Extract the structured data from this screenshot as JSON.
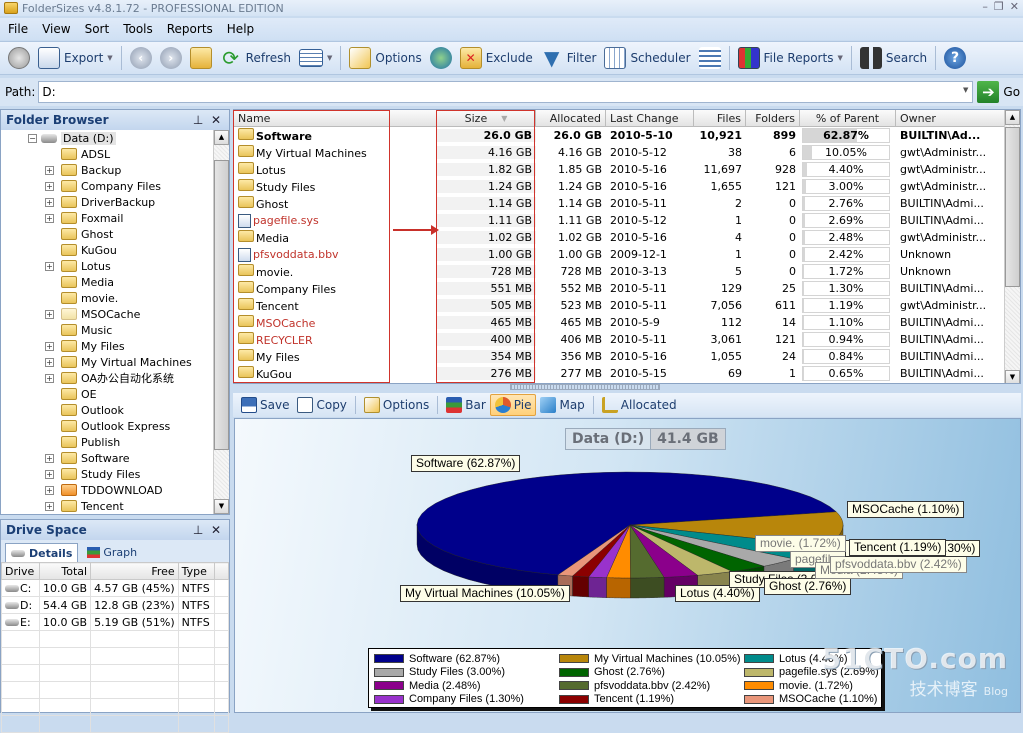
{
  "window": {
    "title": "FolderSizes v4.8.1.72 - PROFESSIONAL EDITION",
    "controls": [
      "minimize",
      "restore",
      "close"
    ]
  },
  "menu": [
    "File",
    "View",
    "Sort",
    "Tools",
    "Reports",
    "Help"
  ],
  "toolbar": {
    "stop": "stop-icon",
    "export": "Export",
    "back": "back-icon",
    "forward": "forward-icon",
    "up": "folder-up-icon",
    "refresh": "Refresh",
    "view_menu": "view-list-icon",
    "options": "Options",
    "network": "network-icon",
    "exclude": "Exclude",
    "filter": "Filter",
    "scheduler": "Scheduler",
    "import": "import-icon",
    "file_reports": "File Reports",
    "search": "Search",
    "help": "help-icon"
  },
  "path": {
    "label": "Path:",
    "value": "D:",
    "go": "Go"
  },
  "folder_browser": {
    "title": "Folder Browser",
    "root": "Data (D:)",
    "items": [
      {
        "name": "ADSL",
        "expandable": false
      },
      {
        "name": "Backup",
        "expandable": true
      },
      {
        "name": "Company Files",
        "expandable": true
      },
      {
        "name": "DriverBackup",
        "expandable": true
      },
      {
        "name": "Foxmail",
        "expandable": true
      },
      {
        "name": "Ghost",
        "expandable": false
      },
      {
        "name": "KuGou",
        "expandable": false
      },
      {
        "name": "Lotus",
        "expandable": true
      },
      {
        "name": "Media",
        "expandable": false
      },
      {
        "name": "movie.",
        "expandable": false
      },
      {
        "name": "MSOCache",
        "expandable": true
      },
      {
        "name": "Music",
        "expandable": false
      },
      {
        "name": "My Files",
        "expandable": true
      },
      {
        "name": "My Virtual Machines",
        "expandable": true
      },
      {
        "name": "OA办公自动化系统",
        "expandable": true
      },
      {
        "name": "OE",
        "expandable": false
      },
      {
        "name": "Outlook",
        "expandable": false
      },
      {
        "name": "Outlook Express",
        "expandable": false
      },
      {
        "name": "Publish",
        "expandable": false
      },
      {
        "name": "Software",
        "expandable": true
      },
      {
        "name": "Study Files",
        "expandable": true
      },
      {
        "name": "TDDOWNLOAD",
        "expandable": true
      },
      {
        "name": "Tencent",
        "expandable": true
      }
    ]
  },
  "drive_space": {
    "title": "Drive Space",
    "tabs": [
      "Details",
      "Graph"
    ],
    "columns": [
      "Drive",
      "Total",
      "Free",
      "Type"
    ],
    "rows": [
      {
        "drive": "C:",
        "total": "10.0 GB",
        "free": "4.57 GB (45%)",
        "type": "NTFS"
      },
      {
        "drive": "D:",
        "total": "54.4 GB",
        "free": "12.8 GB (23%)",
        "type": "NTFS"
      },
      {
        "drive": "E:",
        "total": "10.0 GB",
        "free": "5.19 GB (51%)",
        "type": "NTFS"
      }
    ]
  },
  "grid": {
    "columns": [
      "Name",
      "Size",
      "Allocated",
      "Last Change",
      "Files",
      "Folders",
      "% of Parent",
      "Owner"
    ],
    "sort_column": "Size",
    "rows": [
      {
        "name": "Software",
        "kind": "folder",
        "size": "26.0 GB",
        "allocated": "26.0 GB",
        "last_change": "2010-5-10",
        "files": "10,921",
        "folders": "899",
        "pct": "62.87%",
        "pct_value": 62.87,
        "owner": "BUILTIN\\Ad...",
        "bold": true,
        "red": false
      },
      {
        "name": "My Virtual Machines",
        "kind": "folder",
        "size": "4.16 GB",
        "allocated": "4.16 GB",
        "last_change": "2010-5-12",
        "files": "38",
        "folders": "6",
        "pct": "10.05%",
        "pct_value": 10.05,
        "owner": "gwt\\Administr...",
        "bold": false,
        "red": false
      },
      {
        "name": "Lotus",
        "kind": "folder",
        "size": "1.82 GB",
        "allocated": "1.85 GB",
        "last_change": "2010-5-16",
        "files": "11,697",
        "folders": "928",
        "pct": "4.40%",
        "pct_value": 4.4,
        "owner": "gwt\\Administr...",
        "bold": false,
        "red": false
      },
      {
        "name": "Study Files",
        "kind": "folder",
        "size": "1.24 GB",
        "allocated": "1.24 GB",
        "last_change": "2010-5-16",
        "files": "1,655",
        "folders": "121",
        "pct": "3.00%",
        "pct_value": 3.0,
        "owner": "gwt\\Administr...",
        "bold": false,
        "red": false
      },
      {
        "name": "Ghost",
        "kind": "folder",
        "size": "1.14 GB",
        "allocated": "1.14 GB",
        "last_change": "2010-5-11",
        "files": "2",
        "folders": "0",
        "pct": "2.76%",
        "pct_value": 2.76,
        "owner": "BUILTIN\\Admi...",
        "bold": false,
        "red": false
      },
      {
        "name": "pagefile.sys",
        "kind": "file",
        "size": "1.11 GB",
        "allocated": "1.11 GB",
        "last_change": "2010-5-12",
        "files": "1",
        "folders": "0",
        "pct": "2.69%",
        "pct_value": 2.69,
        "owner": "BUILTIN\\Admi...",
        "bold": false,
        "red": true
      },
      {
        "name": "Media",
        "kind": "folder",
        "size": "1.02 GB",
        "allocated": "1.02 GB",
        "last_change": "2010-5-16",
        "files": "4",
        "folders": "0",
        "pct": "2.48%",
        "pct_value": 2.48,
        "owner": "gwt\\Administr...",
        "bold": false,
        "red": false
      },
      {
        "name": "pfsvoddata.bbv",
        "kind": "file",
        "size": "1.00 GB",
        "allocated": "1.00 GB",
        "last_change": "2009-12-1",
        "files": "1",
        "folders": "0",
        "pct": "2.42%",
        "pct_value": 2.42,
        "owner": "Unknown",
        "bold": false,
        "red": true
      },
      {
        "name": "movie.",
        "kind": "folder",
        "size": "728 MB",
        "allocated": "728 MB",
        "last_change": "2010-3-13",
        "files": "5",
        "folders": "0",
        "pct": "1.72%",
        "pct_value": 1.72,
        "owner": "Unknown",
        "bold": false,
        "red": false
      },
      {
        "name": "Company Files",
        "kind": "folder",
        "size": "551 MB",
        "allocated": "552 MB",
        "last_change": "2010-5-11",
        "files": "129",
        "folders": "25",
        "pct": "1.30%",
        "pct_value": 1.3,
        "owner": "BUILTIN\\Admi...",
        "bold": false,
        "red": false
      },
      {
        "name": "Tencent",
        "kind": "folder",
        "size": "505 MB",
        "allocated": "523 MB",
        "last_change": "2010-5-11",
        "files": "7,056",
        "folders": "611",
        "pct": "1.19%",
        "pct_value": 1.19,
        "owner": "gwt\\Administr...",
        "bold": false,
        "red": false
      },
      {
        "name": "MSOCache",
        "kind": "folder",
        "size": "465 MB",
        "allocated": "465 MB",
        "last_change": "2010-5-9",
        "files": "112",
        "folders": "14",
        "pct": "1.10%",
        "pct_value": 1.1,
        "owner": "BUILTIN\\Admi...",
        "bold": false,
        "red": true
      },
      {
        "name": "RECYCLER",
        "kind": "folder",
        "size": "400 MB",
        "allocated": "406 MB",
        "last_change": "2010-5-11",
        "files": "3,061",
        "folders": "121",
        "pct": "0.94%",
        "pct_value": 0.94,
        "owner": "BUILTIN\\Admi...",
        "bold": false,
        "red": true
      },
      {
        "name": "My Files",
        "kind": "folder",
        "size": "354 MB",
        "allocated": "356 MB",
        "last_change": "2010-5-16",
        "files": "1,055",
        "folders": "24",
        "pct": "0.84%",
        "pct_value": 0.84,
        "owner": "BUILTIN\\Admi...",
        "bold": false,
        "red": false
      },
      {
        "name": "KuGou",
        "kind": "folder",
        "size": "276 MB",
        "allocated": "277 MB",
        "last_change": "2010-5-15",
        "files": "69",
        "folders": "1",
        "pct": "0.65%",
        "pct_value": 0.65,
        "owner": "BUILTIN\\Admi...",
        "bold": false,
        "red": false
      }
    ]
  },
  "chart_toolbar": {
    "save": "Save",
    "copy": "Copy",
    "options": "Options",
    "bar": "Bar",
    "pie": "Pie",
    "map": "Map",
    "allocated": "Allocated",
    "active": "Pie"
  },
  "chart_data": {
    "type": "pie",
    "title": "Data (D:)",
    "total": "41.4 GB",
    "legend_placement": "bottom",
    "slices": [
      {
        "label": "Software",
        "value": 62.87,
        "color": "#00008b"
      },
      {
        "label": "My Virtual Machines",
        "value": 10.05,
        "color": "#b8860b"
      },
      {
        "label": "Lotus",
        "value": 4.4,
        "color": "#008b8b"
      },
      {
        "label": "Study Files",
        "value": 3.0,
        "color": "#a9a9a9"
      },
      {
        "label": "Ghost",
        "value": 2.76,
        "color": "#006400"
      },
      {
        "label": "pagefile.sys",
        "value": 2.69,
        "color": "#bdb76b"
      },
      {
        "label": "Media",
        "value": 2.48,
        "color": "#8b008b"
      },
      {
        "label": "pfsvoddata.bbv",
        "value": 2.42,
        "color": "#556b2f"
      },
      {
        "label": "movie.",
        "value": 1.72,
        "color": "#ff8c00"
      },
      {
        "label": "Company Files",
        "value": 1.3,
        "color": "#9932cc"
      },
      {
        "label": "Tencent",
        "value": 1.19,
        "color": "#8b0000"
      },
      {
        "label": "MSOCache",
        "value": 1.1,
        "color": "#e9967a"
      }
    ],
    "legend": [
      "Software (62.87%)",
      "My Virtual Machines (10.05%)",
      "Lotus (4.40%)",
      "Study Files (3.00%)",
      "Ghost (2.76%)",
      "pagefile.sys (2.69%)",
      "Media (2.48%)",
      "pfsvoddata.bbv (2.42%)",
      "movie. (1.72%)",
      "Company Files (1.30%)",
      "Tencent (1.19%)",
      "MSOCache (1.10%)"
    ],
    "callouts": [
      "Software (62.87%)",
      "My Virtual Machines (10.05%)",
      "Lotus (4.40%)",
      "Study Files (3.00%)",
      "Ghost (2.76%)",
      "pagefile.sys (2.69%)",
      "Media (2.48%)",
      "pfsvoddata.bbv (2.42%)",
      "Company Files (1.30%)",
      "Tencent (1.19%)",
      "MSOCache (1.10%)",
      "movie. (1.72%)"
    ]
  },
  "watermark": {
    "line1": "51CTO.com",
    "line2": "技术博客",
    "line3": "Blog"
  }
}
